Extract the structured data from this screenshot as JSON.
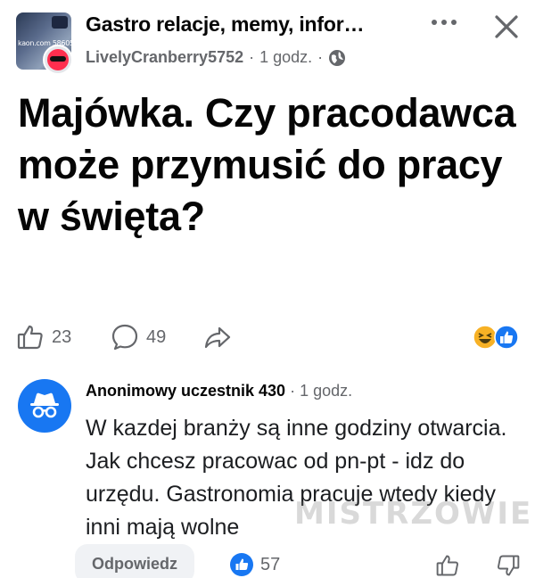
{
  "header": {
    "group_name": "Gastro relacje, memy, infor…",
    "thumb_tag": "kaon.com 5860535",
    "author": "LivelyCranberry5752",
    "separator": "·",
    "time": "1 godz.",
    "separator2": "·",
    "privacy_icon": "globe-icon",
    "more_icon": "more-dots-icon",
    "close_icon": "close-icon"
  },
  "post": {
    "title": "Majówka. Czy pracodawca może przymusić do pracy w święta?"
  },
  "actions": {
    "like_count": "23",
    "comment_count": "49",
    "like_icon": "thumbs-up-outline-icon",
    "comment_icon": "comment-bubble-icon",
    "share_icon": "share-arrow-icon",
    "reaction_icons": [
      "haha-reaction-icon",
      "like-reaction-icon"
    ]
  },
  "comment": {
    "author": "Anonimowy uczestnik 430",
    "separator": "·",
    "time": "1 godz.",
    "text": "W kazdej branży są inne godziny otwarcia. Jak chcesz pracowac od pn-pt - idz do urzędu. Gastronomia pracuje wtedy kiedy inni mają wolne",
    "reply_label": "Odpowiedz",
    "like_count": "57"
  },
  "watermark": "MISTRZOWIE",
  "colors": {
    "accent": "#1877f2",
    "text_primary": "#050505",
    "text_secondary": "#65676b",
    "reply_bg": "#f0f2f5",
    "haha": "#f7b125"
  }
}
